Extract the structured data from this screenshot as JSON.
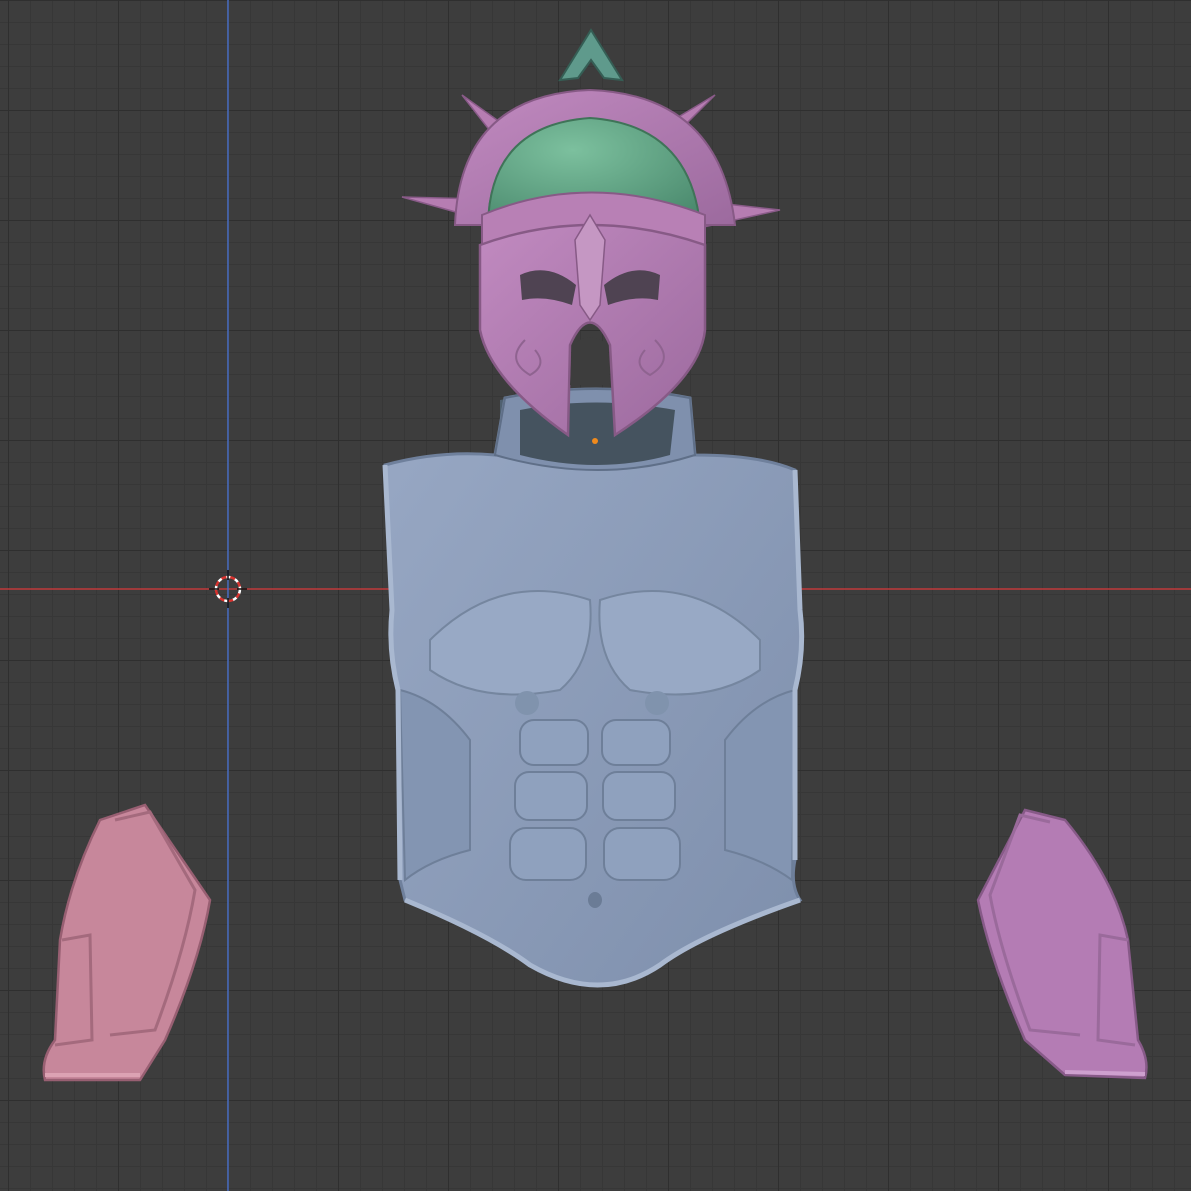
{
  "viewport": {
    "background": "#3d3d3d",
    "grid_minor": "#373737",
    "grid_major": "#2f2f2f",
    "x_axis_color": "#c0393b",
    "y_axis_color": "#4a6fc4",
    "origin_marker_color": "#f08a1c"
  },
  "objects": [
    {
      "name": "helmet",
      "color_main": "#b97ab4",
      "color_crest": "#5fa585",
      "color_spike": "#4f8a7c"
    },
    {
      "name": "breastplate",
      "color_main": "#8b9cb8"
    },
    {
      "name": "left-bracer",
      "color_main": "#c7879b"
    },
    {
      "name": "right-bracer",
      "color_main": "#b47cb4"
    }
  ],
  "tools": {
    "cursor_3d": "3d-cursor-icon"
  }
}
